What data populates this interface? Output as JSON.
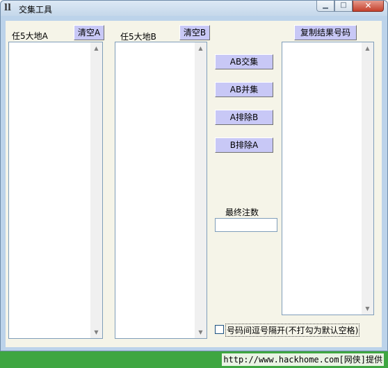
{
  "window": {
    "title": "交集工具",
    "icon": "ll-app-icon",
    "controls": {
      "minimize": "▁",
      "maximize": "□",
      "close": "✕"
    }
  },
  "list_a": {
    "label": "任5大地A",
    "clear_button": "清空A"
  },
  "list_b": {
    "label": "任5大地B",
    "clear_button": "清空B"
  },
  "operations": {
    "intersection": "AB交集",
    "union": "AB并集",
    "a_minus_b": "A排除B",
    "b_minus_a": "B排除A"
  },
  "result": {
    "copy_button": "复制结果号码"
  },
  "final_count": {
    "label": "最终注数",
    "value": ""
  },
  "separator_option": {
    "label": "号码间逗号隔开(不打勾为默认空格)",
    "checked": false
  },
  "watermark": "http://www.hackhome.com[网侠]提供"
}
